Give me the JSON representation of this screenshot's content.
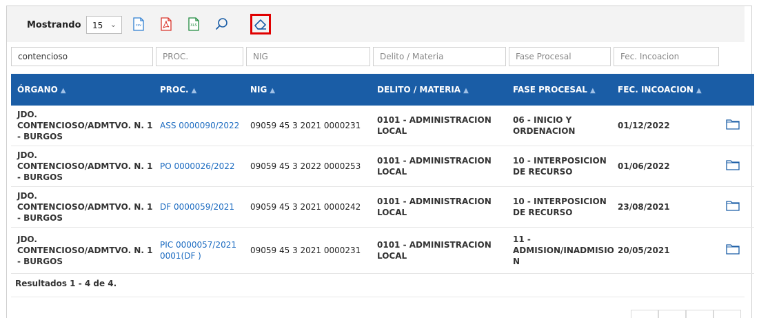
{
  "toolbar": {
    "showing_label": "Mostrando",
    "page_size": "15",
    "csv_label": "csv",
    "xls_label": "XLS",
    "accent": "#e00000"
  },
  "filters": {
    "organo_value": "contencioso",
    "proc_placeholder": "PROC.",
    "nig_placeholder": "NIG",
    "delito_placeholder": "Delito / Materia",
    "fase_placeholder": "Fase Procesal",
    "fec_placeholder": "Fec. Incoacion"
  },
  "table": {
    "header_color": "#1a5da6",
    "columns": [
      "ÓRGANO",
      "PROC.",
      "NIG",
      "DELITO / MATERIA",
      "FASE PROCESAL",
      "FEC. INCOACION"
    ],
    "rows": [
      {
        "organo": "JDO. CONTENCIOSO/ADMTVO. N. 1 - BURGOS",
        "proc": "ASS 0000090/2022",
        "nig": "09059 45 3 2021 0000231",
        "delito": "0101 - ADMINISTRACION LOCAL",
        "fase": "06 - INICIO Y ORDENACION",
        "fecha": "01/12/2022"
      },
      {
        "organo": "JDO. CONTENCIOSO/ADMTVO. N. 1 - BURGOS",
        "proc": "PO 0000026/2022",
        "nig": "09059 45 3 2022 0000253",
        "delito": "0101 - ADMINISTRACION LOCAL",
        "fase": "10 - INTERPOSICION DE RECURSO",
        "fecha": "01/06/2022"
      },
      {
        "organo": "JDO. CONTENCIOSO/ADMTVO. N. 1 - BURGOS",
        "proc": "DF 0000059/2021",
        "nig": "09059 45 3 2021 0000242",
        "delito": "0101 - ADMINISTRACION LOCAL",
        "fase": "10 - INTERPOSICION DE RECURSO",
        "fecha": "23/08/2021"
      },
      {
        "organo": "JDO. CONTENCIOSO/ADMTVO. N. 1 - BURGOS",
        "proc": "PIC 0000057/2021 0001(DF )",
        "nig": "09059 45 3 2021 0000231",
        "delito": "0101 - ADMINISTRACION LOCAL",
        "fase": "11 - ADMISION/INADMISIO N",
        "fecha": "20/05/2021"
      }
    ]
  },
  "footer": {
    "results_text": "Resultados 1 - 4 de 4."
  }
}
